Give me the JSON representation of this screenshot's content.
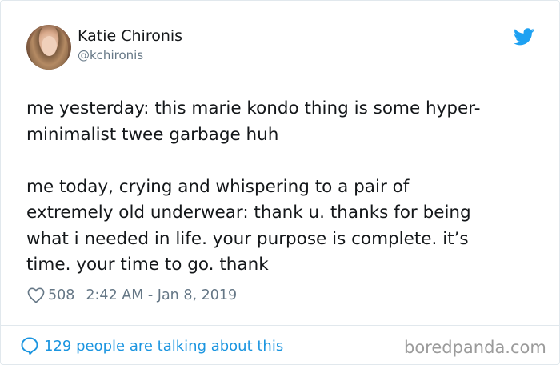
{
  "author": {
    "name": "Katie Chironis",
    "handle": "@kchironis"
  },
  "tweet": {
    "text": "me yesterday: this marie kondo thing is some hyper-\nminimalist twee garbage huh\n\nme today, crying and whispering to a pair of\nextremely old underwear: thank u. thanks for being\nwhat i needed in life. your purpose is complete. it’s\ntime. your time to go. thank",
    "likes": "508",
    "timestamp": "2:42 AM - Jan 8, 2019"
  },
  "footer": {
    "talking_label": "129 people are talking about this",
    "watermark": "boredpanda.com"
  },
  "icons": {
    "brand": "twitter-bird-icon",
    "like": "heart-icon",
    "reply": "speech-bubble-icon"
  },
  "colors": {
    "twitter_blue": "#1da1f2",
    "link_blue": "#1b95e0",
    "secondary_text": "#657786",
    "watermark_gray": "#9b9b9b"
  }
}
